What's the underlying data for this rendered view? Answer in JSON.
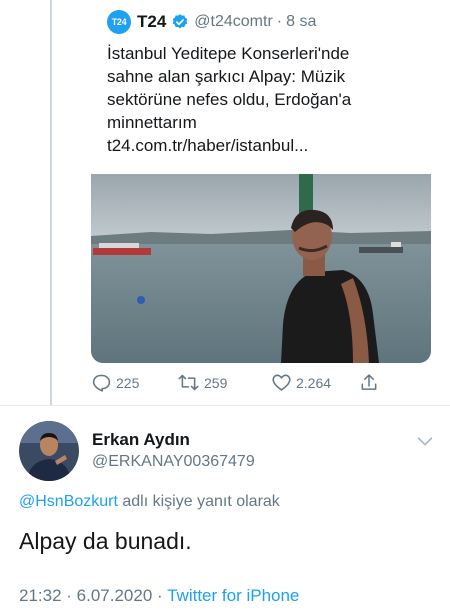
{
  "quoted_tweet": {
    "avatar_text": "T24",
    "name": "T24",
    "handle": "@t24comtr",
    "separator": "·",
    "time": "8 sa",
    "text_lines": [
      "İstanbul Yeditepe Konserleri'nde",
      "sahne alan şarkıcı Alpay: Müzik",
      "sektörüne nefes oldu, Erdoğan'a",
      "minnettarım",
      "t24.com.tr/haber/istanbul..."
    ]
  },
  "actions": {
    "reply_count": "225",
    "retweet_count": "259",
    "like_count": "2.264"
  },
  "tweet": {
    "author_name": "Erkan Aydın",
    "author_handle": "@ERKANAY00367479",
    "reply_mention": "@HsnBozkurt",
    "reply_suffix": " adlı kişiye yanıt olarak",
    "text": "Alpay da bunadı.",
    "time": "21:32",
    "separator1": " · ",
    "date": "6.07.2020",
    "separator2": " · ",
    "source": "Twitter for iPhone"
  },
  "icons": [
    "verified-badge-icon",
    "reply-icon",
    "retweet-icon",
    "like-icon",
    "share-icon",
    "chevron-down-icon"
  ],
  "colors": {
    "accent": "#1da1f2",
    "secondary_text": "#657786",
    "primary_text": "#14171a"
  }
}
